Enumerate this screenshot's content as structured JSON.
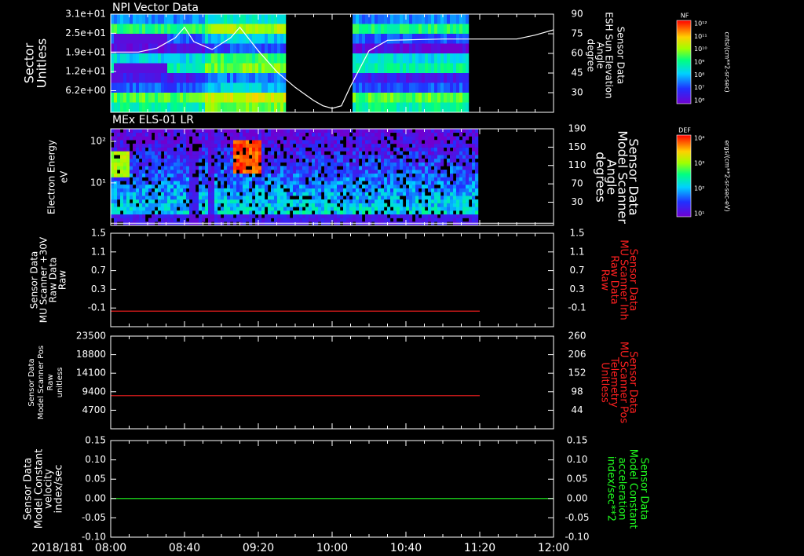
{
  "colors": {
    "white": "#ffffff",
    "red": "#ff2020",
    "green": "#20ff20",
    "black": "#000000"
  },
  "x_axis": {
    "date_label": "2018/181",
    "ticks": [
      "08:00",
      "08:40",
      "09:20",
      "10:00",
      "10:40",
      "11:20",
      "12:00"
    ]
  },
  "colorbars": [
    {
      "title": "NF",
      "units": "cnts/(cm**2-sr-sec)",
      "tick_labels": [
        "10¹²",
        "10¹¹",
        "10¹⁰",
        "10⁹",
        "10⁸",
        "10⁷",
        "10⁶"
      ]
    },
    {
      "title": "DEF",
      "units": "ergs/(cm**2-sr-sec-eV)",
      "tick_labels": [
        "10⁴",
        "10³",
        "10²",
        "10¹"
      ]
    }
  ],
  "chart_data": [
    {
      "type": "heatmap",
      "title": "NPI Vector Data",
      "ylabel": [
        "Sector",
        "Unitless"
      ],
      "yticks": [
        "3.1e+01",
        "2.5e+01",
        "1.9e+01",
        "1.2e+01",
        "6.2e+00"
      ],
      "y2label": [
        "Sensor Data",
        "ESH Sun Elevation",
        "Angle",
        "degree"
      ],
      "y2ticks": [
        "90",
        "75",
        "60",
        "45",
        "30"
      ],
      "y2lim": [
        15,
        90
      ],
      "data_gap": [
        "09:35",
        "10:10"
      ],
      "data_end": "11:13",
      "overlay_line": {
        "name": "ESH Sun Elevation Angle",
        "x": [
          "08:00",
          "08:15",
          "08:25",
          "08:35",
          "08:40",
          "08:45",
          "08:55",
          "09:05",
          "09:10",
          "09:20",
          "09:30",
          "09:40",
          "09:50",
          "09:55",
          "10:00",
          "10:05",
          "10:10",
          "10:20",
          "10:30",
          "11:00",
          "11:40",
          "11:50",
          "12:00"
        ],
        "values": [
          61,
          61,
          64,
          72,
          80,
          69,
          63,
          72,
          80,
          62,
          46,
          34,
          24,
          20,
          18,
          20,
          35,
          62,
          70,
          71,
          71,
          74,
          78
        ]
      }
    },
    {
      "type": "heatmap",
      "title": "MEx ELS-01 LR",
      "ylabel": [
        "Electron Energy",
        "eV"
      ],
      "yticks": [
        "10²",
        "10¹"
      ],
      "yscale": "log",
      "y2label": [
        "Sensor Data",
        "Model Scanner",
        "Angle",
        "degrees"
      ],
      "y2ticks": [
        "190",
        "150",
        "110",
        "70",
        "30"
      ],
      "y2lim": [
        10,
        190
      ],
      "data_end": "11:18",
      "overlay_line": {
        "name": "Model Scanner Angle",
        "x": [
          "08:00",
          "12:00"
        ],
        "values": [
          14,
          14
        ]
      }
    },
    {
      "type": "line",
      "ylabel": [
        "Sensor Data",
        "MU Scanner +30V",
        "Raw Data",
        "Raw"
      ],
      "yticks": [
        "1.5",
        "1.1",
        "0.7",
        "0.3",
        "-0.1"
      ],
      "ylim": [
        -0.3,
        1.5
      ],
      "y2label": [
        "Sensor Data",
        "MU Scanner Inh",
        "Raw Data",
        "Raw"
      ],
      "y2ticks": [
        "1.5",
        "1.1",
        "0.7",
        "0.3",
        "-0.1"
      ],
      "series": [
        {
          "x": [
            "08:00",
            "11:20"
          ],
          "values": [
            0.0,
            0.0
          ]
        }
      ]
    },
    {
      "type": "line",
      "ylabel": [
        "Sensor Data",
        "Model Scanner Pos",
        "Raw",
        "unitless"
      ],
      "yticks": [
        "23500",
        "18800",
        "14100",
        "9400",
        "4700"
      ],
      "ylim": [
        0,
        23500
      ],
      "y2label": [
        "Sensor Data",
        "MU Scanner Pos",
        "Telemetry",
        "Unitless"
      ],
      "y2ticks": [
        "260",
        "206",
        "152",
        "98",
        "44"
      ],
      "series": [
        {
          "x": [
            "08:00",
            "11:20"
          ],
          "values": [
            8400,
            8400
          ]
        }
      ]
    },
    {
      "type": "line",
      "ylabel": [
        "Sensor Data",
        "Model Constant",
        "velocity",
        "index/sec"
      ],
      "yticks": [
        "0.15",
        "0.10",
        "0.05",
        "0.00",
        "-0.05",
        "-0.10"
      ],
      "ylim": [
        -0.1,
        0.15
      ],
      "y2label": [
        "Sensor Data",
        "Model Constant",
        "acceleration",
        "index/sec**2"
      ],
      "y2ticks": [
        "0.15",
        "0.10",
        "0.05",
        "0.00",
        "-0.05",
        "-0.10"
      ],
      "series": [
        {
          "x": [
            "08:00",
            "12:00"
          ],
          "values": [
            0.0,
            0.0
          ]
        }
      ]
    }
  ]
}
